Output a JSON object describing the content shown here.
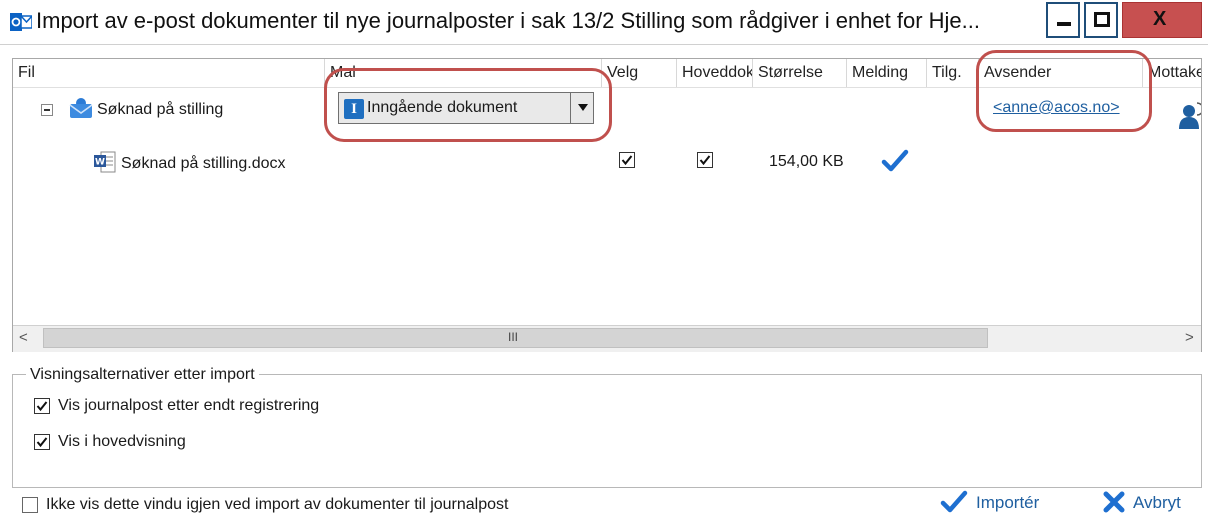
{
  "window": {
    "title": "Import av e-post dokumenter til nye journalposter i sak 13/2 Stilling som rådgiver i enhet for Hje...",
    "min_glyph": "—",
    "max_glyph": "□",
    "close_glyph": "X"
  },
  "grid": {
    "columns": [
      "Fil",
      "Mal",
      "Velg",
      "Hoveddok",
      "Størrelse",
      "Melding",
      "Tilg.",
      "Avsender",
      "Mottaker"
    ],
    "rows": [
      {
        "file": "Søknad på stilling",
        "template": "Inngående dokument",
        "sender": "<anne@acos.no>"
      },
      {
        "file": "Søknad på stilling.docx",
        "velg": true,
        "hoveddok": true,
        "size": "154,00 KB",
        "melding": true
      }
    ],
    "scroll_grip": "III",
    "scroll_left": "<",
    "scroll_right": ">"
  },
  "options": {
    "group_title": "Visningsalternativer etter import",
    "items": [
      {
        "label": "Vis journalpost etter endt registrering",
        "checked": true
      },
      {
        "label": "Vis i hovedvisning",
        "checked": true
      }
    ]
  },
  "footer": {
    "dont_show_label": "Ikke vis dette vindu igjen ved import av dokumenter til journalpost",
    "dont_show_checked": false,
    "import_label": "Importér",
    "cancel_label": "Avbryt"
  },
  "colors": {
    "highlight": "#c0504d",
    "accent": "#1f5fa0",
    "check_blue": "#1e6fd0"
  }
}
